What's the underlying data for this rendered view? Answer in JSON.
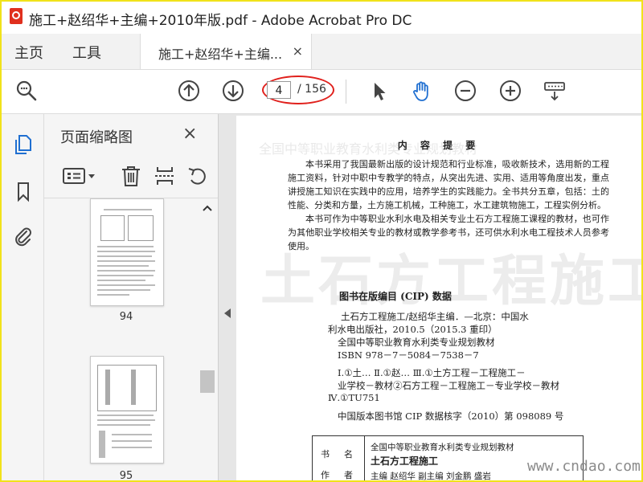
{
  "window": {
    "title": "施工+赵绍华+主编+2010年版.pdf - Adobe Acrobat Pro DC"
  },
  "nav": {
    "home": "主页",
    "tools": "工具"
  },
  "doc_tab": {
    "label": "施工+赵绍华+主编...",
    "close": "×"
  },
  "toolbar": {
    "current_page": "4",
    "total_pages": "/ 156"
  },
  "panel": {
    "title": "页面缩略图",
    "close": "×",
    "thumbnails": [
      {
        "label": "94"
      },
      {
        "label": "95"
      }
    ]
  },
  "page": {
    "section_title": "内 容 提 要",
    "para1": "本书采用了我国最新出版的设计规范和行业标准，吸收新技术，选用新的工程施工资料，针对中职中专教学的特点，从突出先进、实用、适用等角度出发，重点讲授施工知识在实践中的应用，培养学生的实践能力。全书共分五章，包括：土的性能、分类和方量，土方施工机械，工种施工，水工建筑物施工，工程实例分析。",
    "para2": "本书可作为中等职业水利水电及相关专业土石方工程施工课程的教材，也可作为其他职业学校相关专业的教材或教学参考书，还可供水利水电工程技术人员参考使用。",
    "watermark_big": "土石方工程施工",
    "watermark_top": "全国中等职业教育水利类专业规划教材",
    "cip_title": "图书在版编目 (CIP) 数据",
    "cip_lines": [
      "土石方工程施工/赵绍华主编．—北京：中国水",
      "利水电出版社，2010.5（2015.3 重印）",
      "全国中等职业教育水利类专业规划教材",
      "ISBN 978－7－5084－7538－7",
      "Ⅰ.①土…  Ⅱ.①赵…  Ⅲ.①土方工程－工程施工－",
      "业学校－教材②石方工程－工程施工－专业学校－教材",
      "Ⅳ.①TU751",
      "中国版本图书馆 CIP 数据核字（2010）第 098089 号"
    ],
    "table": {
      "label1": "书名",
      "label2": "作者",
      "series": "全国中等职业教育水利类专业规划教材",
      "book_title": "土石方工程施工",
      "authors": "主编  赵绍华    副主编  刘金鹏  盛岩"
    }
  },
  "site_watermark": "www.cndao.com"
}
